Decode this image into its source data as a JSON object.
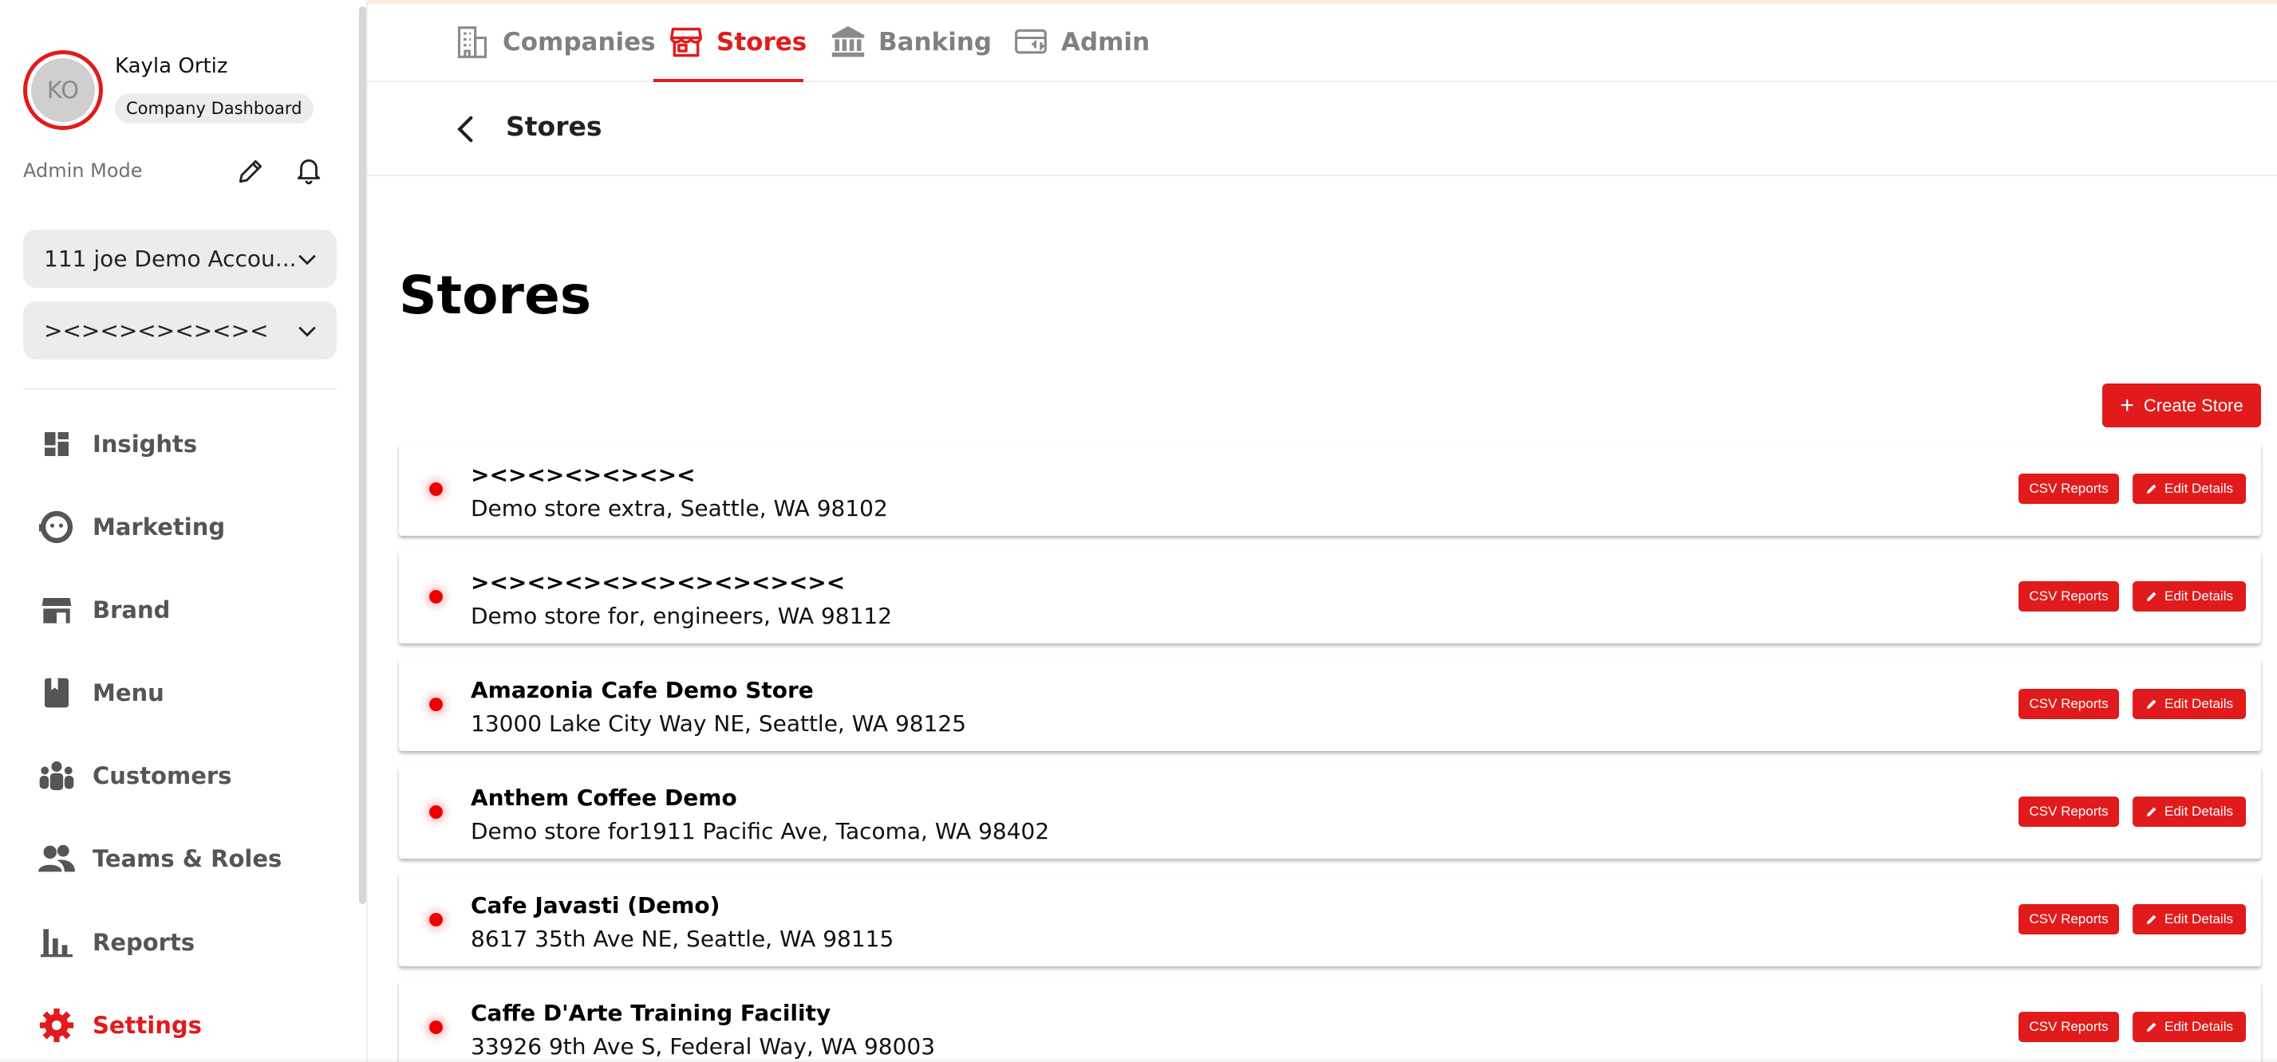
{
  "user": {
    "name": "Kayla Ortiz",
    "initials": "KO",
    "role": "Company Dashboard",
    "mode": "Admin Mode"
  },
  "selectors": {
    "account": "111 joe Demo Accou...",
    "store": "><><><><><><"
  },
  "nav": [
    {
      "label": "Insights",
      "icon": "dashboard-icon",
      "active": false
    },
    {
      "label": "Marketing",
      "icon": "marketing-icon",
      "active": false
    },
    {
      "label": "Brand",
      "icon": "storefront-icon",
      "active": false
    },
    {
      "label": "Menu",
      "icon": "book-icon",
      "active": false
    },
    {
      "label": "Customers",
      "icon": "people-icon",
      "active": false
    },
    {
      "label": "Teams & Roles",
      "icon": "team-icon",
      "active": false
    },
    {
      "label": "Reports",
      "icon": "bar-chart-icon",
      "active": false
    },
    {
      "label": "Settings",
      "icon": "gear-icon",
      "active": true
    }
  ],
  "tabs": [
    {
      "label": "Companies",
      "icon": "building-icon",
      "active": false
    },
    {
      "label": "Stores",
      "icon": "store-icon",
      "active": true
    },
    {
      "label": "Banking",
      "icon": "bank-icon",
      "active": false
    },
    {
      "label": "Admin",
      "icon": "admin-card-icon",
      "active": false
    }
  ],
  "subheader": {
    "title": "Stores"
  },
  "page": {
    "title": "Stores",
    "create_label": "Create Store"
  },
  "stores": [
    {
      "name": "><><><><><><",
      "address": "Demo store extra, Seattle, WA 98102",
      "status_color": "#ee0000"
    },
    {
      "name": "><><><><><><><><><><",
      "address": "Demo store for, engineers, WA 98112",
      "status_color": "#ee0000"
    },
    {
      "name": "Amazonia Cafe Demo Store",
      "address": "13000 Lake City Way NE, Seattle, WA 98125",
      "status_color": "#ee0000"
    },
    {
      "name": "Anthem Coffee Demo",
      "address": "Demo store for1911 Pacific Ave, Tacoma, WA 98402",
      "status_color": "#ee0000"
    },
    {
      "name": "Cafe Javasti (Demo)",
      "address": "8617 35th Ave NE, Seattle, WA 98115",
      "status_color": "#ee0000"
    },
    {
      "name": "Caffe D'Arte Training Facility",
      "address": "33926 9th Ave S, Federal Way, WA 98003",
      "status_color": "#ee0000"
    }
  ],
  "row_actions": {
    "csv_label": "CSV Reports",
    "edit_label": "Edit Details"
  },
  "colors": {
    "accent": "#e11b1b",
    "status_offline": "#ee0000",
    "nav_text": "#555555",
    "tab_inactive": "#808080"
  }
}
